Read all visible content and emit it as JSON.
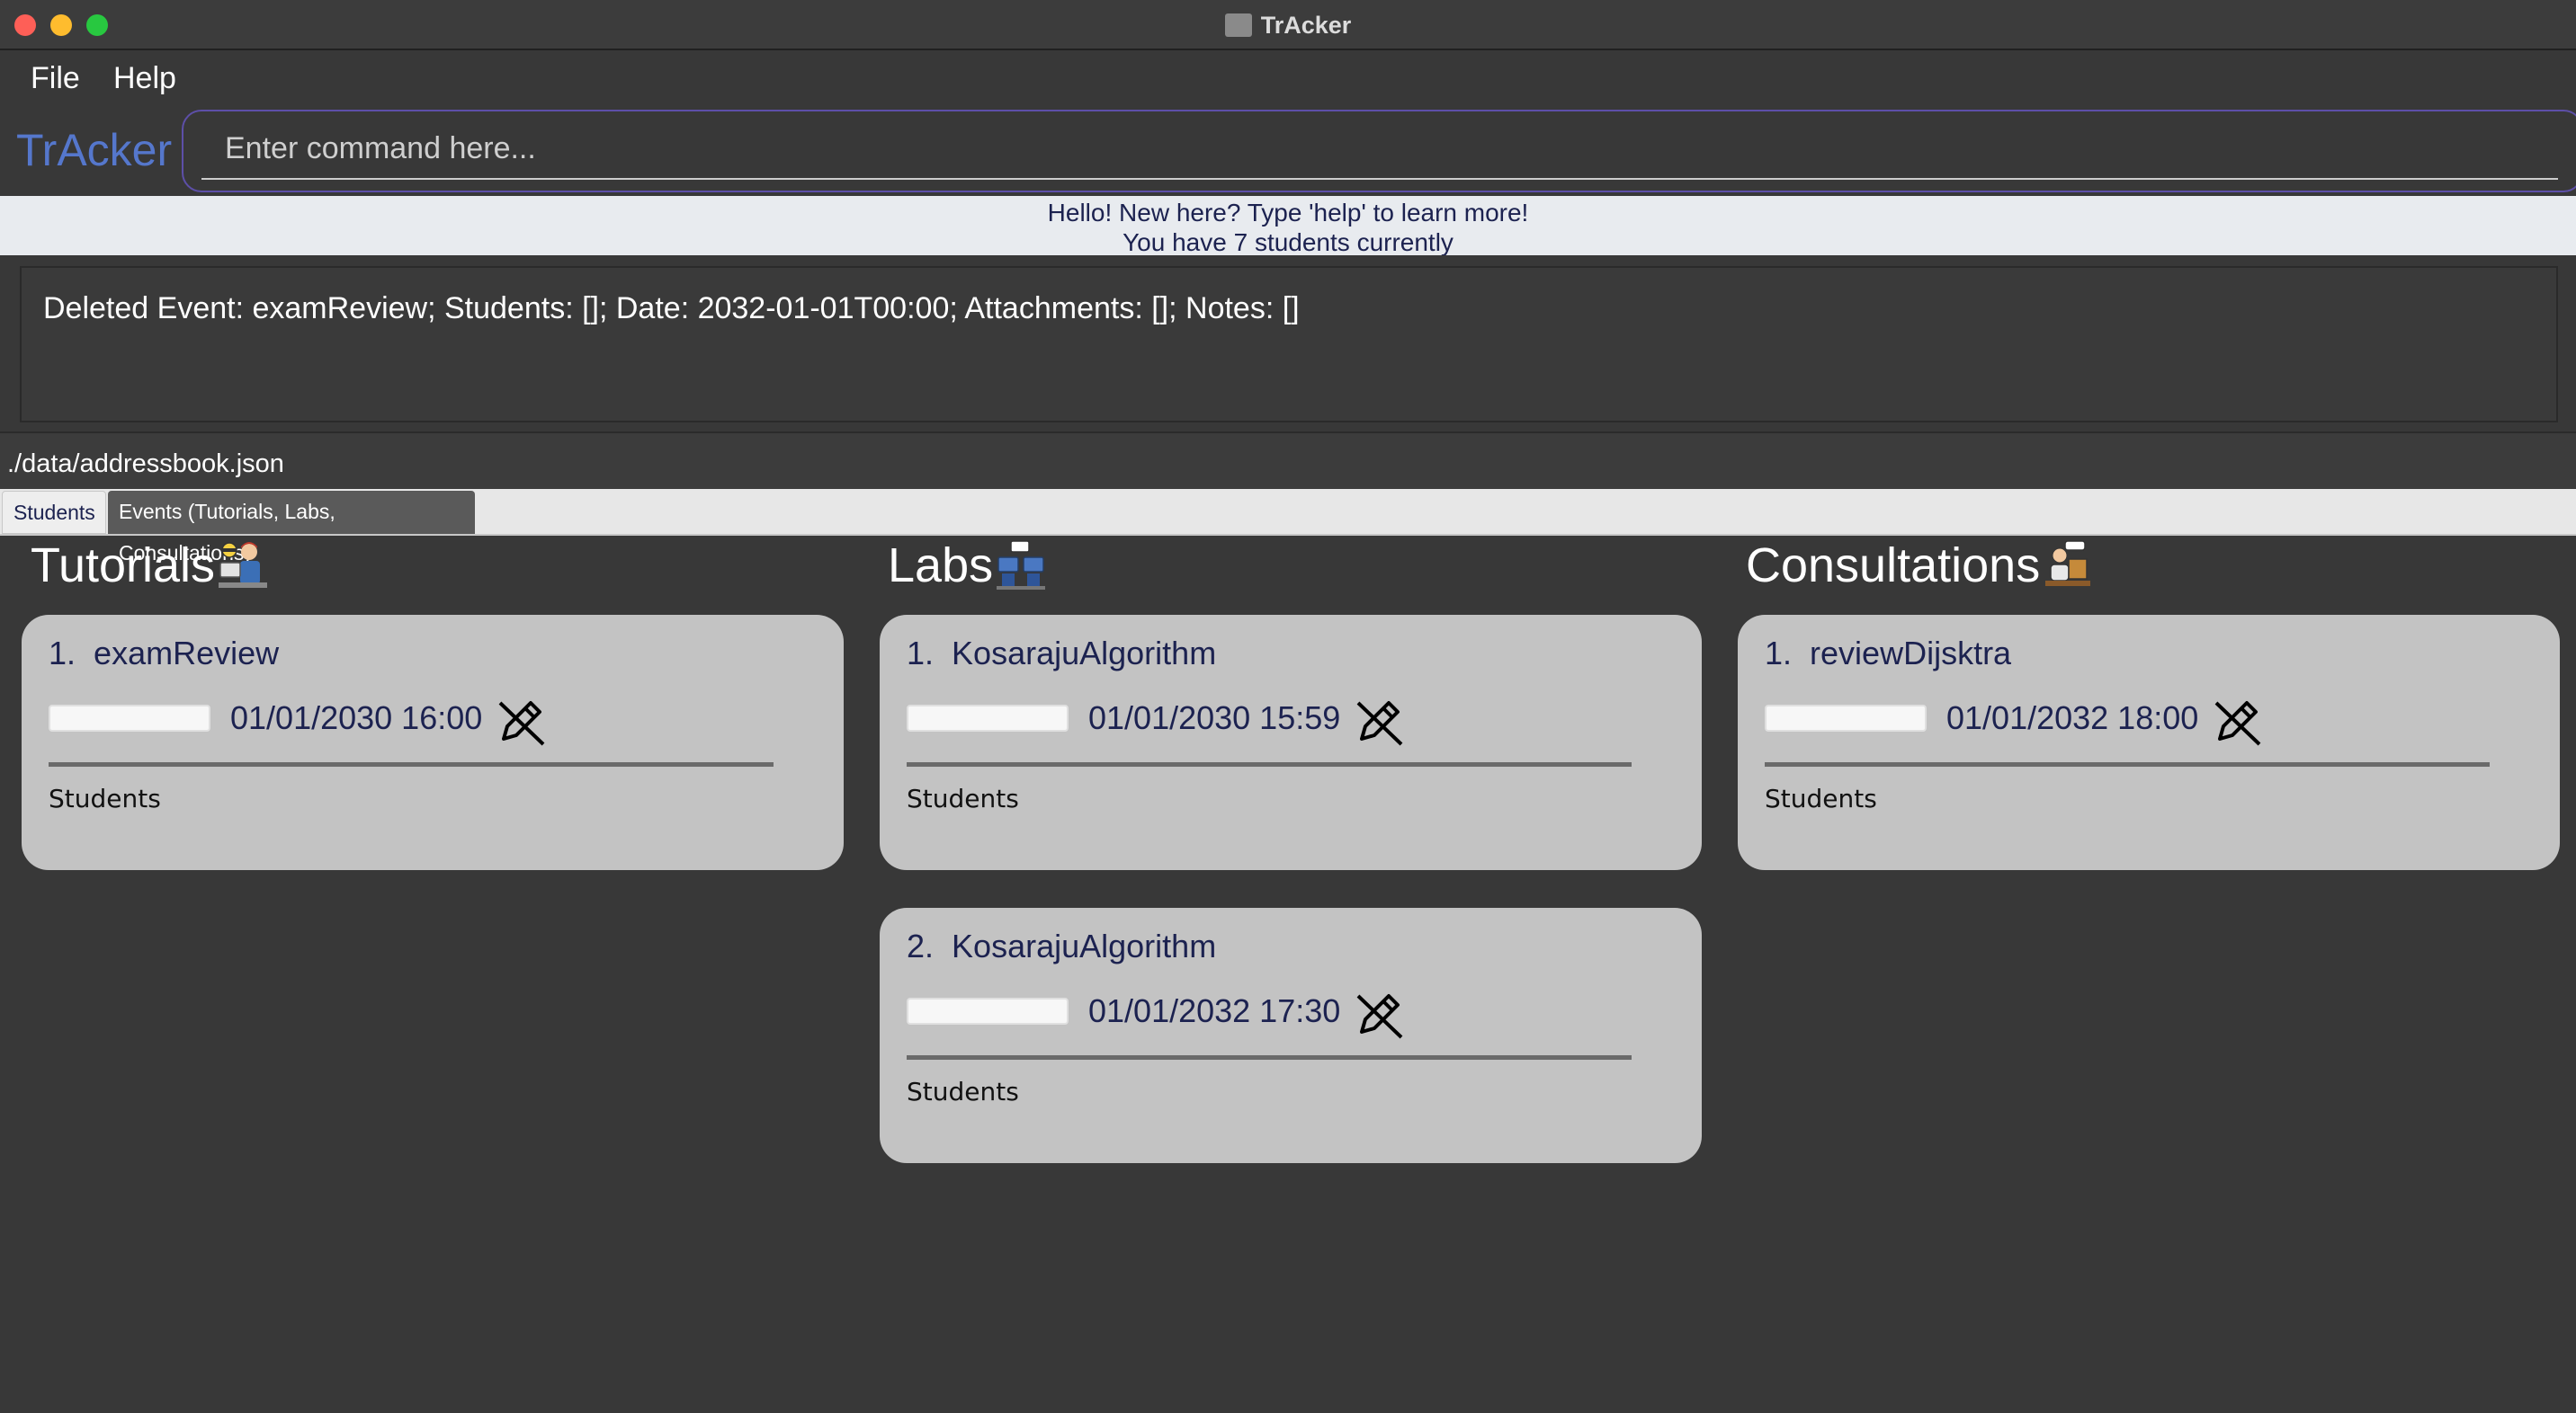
{
  "window": {
    "title": "TrAcker"
  },
  "menu": {
    "file": "File",
    "help": "Help"
  },
  "brand": "TrAcker",
  "command": {
    "placeholder": "Enter command here...",
    "value": ""
  },
  "welcome": {
    "line1": "Hello! New here? Type 'help' to learn more!",
    "line2": "You have 7 students currently"
  },
  "result": "Deleted Event: examReview; Students: []; Date: 2032-01-01T00:00; Attachments: []; Notes: []",
  "status": {
    "path": "./data/addressbook.json"
  },
  "tabs": [
    {
      "label": "Students",
      "selected": false
    },
    {
      "label": "Events (Tutorials, Labs, Consultations)",
      "selected": true
    }
  ],
  "columns": {
    "tutorials": {
      "title": "Tutorials",
      "icon": "teacher-icon",
      "cards": [
        {
          "index": "1.",
          "name": "examReview",
          "date": "01/01/2030 16:00",
          "students_label": "Students"
        }
      ]
    },
    "labs": {
      "title": "Labs",
      "icon": "lab-icon",
      "cards": [
        {
          "index": "1.",
          "name": "KosarajuAlgorithm",
          "date": "01/01/2030 15:59",
          "students_label": "Students"
        },
        {
          "index": "2.",
          "name": "KosarajuAlgorithm",
          "date": "01/01/2032 17:30",
          "students_label": "Students"
        }
      ]
    },
    "consultations": {
      "title": "Consultations",
      "icon": "consultation-icon",
      "cards": [
        {
          "index": "1.",
          "name": "reviewDijsktra",
          "date": "01/01/2032 18:00",
          "students_label": "Students"
        }
      ]
    }
  },
  "colors": {
    "background": "#383838",
    "brand": "#5577cc",
    "card": "#c3c3c3",
    "card_text": "#1c2250"
  }
}
